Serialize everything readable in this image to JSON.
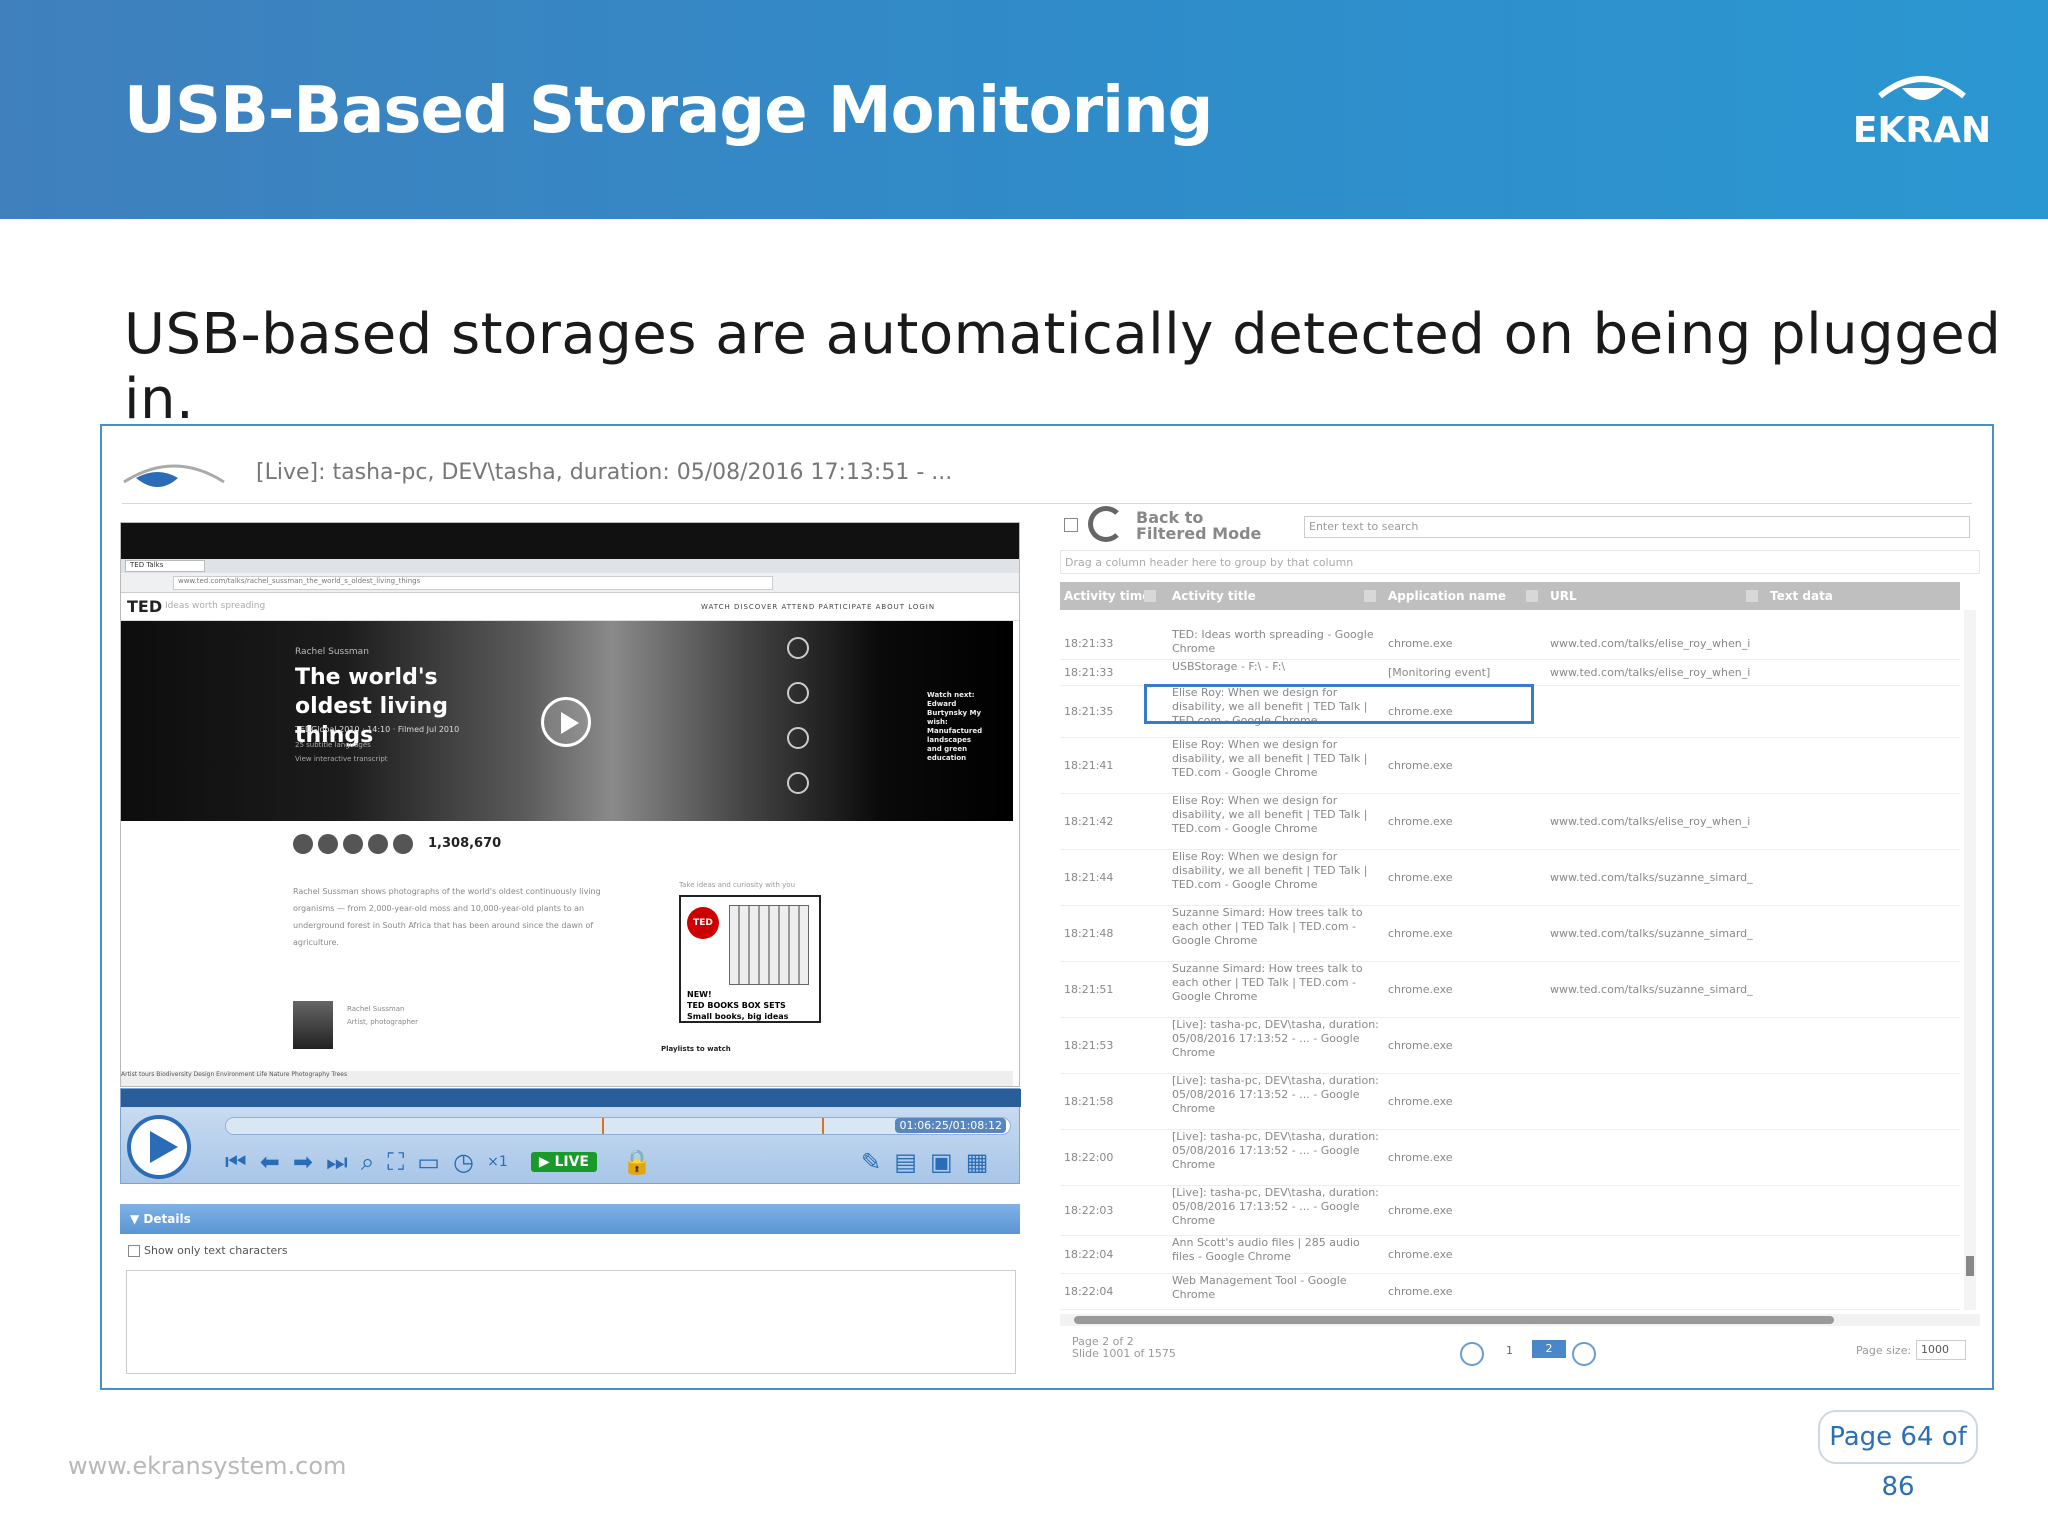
{
  "slide": {
    "title": "USB-Based Storage Monitoring",
    "subtitle": "USB-based storages are automatically detected on being plugged in.",
    "logo_text": "EKRAN",
    "page": "Page 64 of 86",
    "website": "www.ekransystem.com"
  },
  "session": {
    "header": "[Live]: tasha-pc, DEV\\tasha, duration: 05/08/2016 17:13:51 - ..."
  },
  "video": {
    "tab_label": "TED Talks",
    "address": "www.ted.com/talks/rachel_sussman_the_world_s_oldest_living_things",
    "ted_logo": "TED",
    "ted_tagline": "Ideas worth spreading",
    "menu": "WATCH   DISCOVER   ATTEND   PARTICIPATE   ABOUT   LOGIN",
    "speaker_name": "Rachel Sussman",
    "talk_title": "The world's oldest living things",
    "talk_meta": "TEDGlobal 2010 · 14:10 · Filmed Jul 2010",
    "subtitles": "25 subtitle languages",
    "download": "View interactive transcript",
    "side_text": "Watch next: Edward Burtynsky My wish: Manufactured landscapes and green education",
    "views": "1,308,670",
    "description": "Rachel Sussman shows photographs of the world's oldest continuously living organisms — from 2,000-year-old moss and 10,000-year-old plants to an underground forest in South Africa that has been around since the dawn of agriculture.",
    "ad_top": "Take ideas and curiosity with you",
    "ad_logo": "TED",
    "ad_label": "NEW!\nTED BOOKS BOX SETS\nSmall books, big ideas",
    "speaker_caption": "Rachel Sussman\nArtist, photographer",
    "playlist": "Playlists to watch",
    "strip": "Artist tours   Biodiversity   Design   Environment   Life   Nature   Photography   Trees"
  },
  "controls": {
    "timecode": "01:06:25/01:08:12",
    "live_label": "▶ LIVE",
    "speed": "×1",
    "progress_fraction": 0.89,
    "markers": [
      0.48,
      0.76
    ]
  },
  "details": {
    "title": "Details",
    "checkbox_label": "Show only text characters"
  },
  "grid": {
    "back_label": "Back to Filtered Mode",
    "search_placeholder": "Enter text to search",
    "group_hint": "Drag a column header here to group by that column",
    "columns": [
      "Activity time",
      "Activity title",
      "Application name",
      "URL",
      "Text data"
    ],
    "rows": [
      {
        "time": "18:21:33",
        "title": "TED: Ideas worth spreading - Google Chrome",
        "app": "chrome.exe",
        "url": "www.ted.com/talks/elise_roy_when_i"
      },
      {
        "time": "18:21:33",
        "title": "USBStorage - F:\\ - F:\\",
        "app": "[Monitoring event]",
        "url": "www.ted.com/talks/elise_roy_when_i"
      },
      {
        "time": "18:21:35",
        "title": "Elise Roy: When we design for disability, we all benefit | TED Talk | TED.com - Google Chrome",
        "app": "chrome.exe",
        "url": ""
      },
      {
        "time": "18:21:41",
        "title": "Elise Roy: When we design for disability, we all benefit | TED Talk | TED.com - Google Chrome",
        "app": "chrome.exe",
        "url": ""
      },
      {
        "time": "18:21:42",
        "title": "Elise Roy: When we design for disability, we all benefit | TED Talk | TED.com - Google Chrome",
        "app": "chrome.exe",
        "url": "www.ted.com/talks/elise_roy_when_i"
      },
      {
        "time": "18:21:44",
        "title": "Elise Roy: When we design for disability, we all benefit | TED Talk | TED.com - Google Chrome",
        "app": "chrome.exe",
        "url": "www.ted.com/talks/suzanne_simard_"
      },
      {
        "time": "18:21:48",
        "title": "Suzanne Simard: How trees talk to each other | TED Talk | TED.com - Google Chrome",
        "app": "chrome.exe",
        "url": "www.ted.com/talks/suzanne_simard_"
      },
      {
        "time": "18:21:51",
        "title": "Suzanne Simard: How trees talk to each other | TED Talk | TED.com - Google Chrome",
        "app": "chrome.exe",
        "url": "www.ted.com/talks/suzanne_simard_"
      },
      {
        "time": "18:21:53",
        "title": "[Live]: tasha-pc, DEV\\tasha, duration: 05/08/2016 17:13:52 - ... - Google Chrome",
        "app": "chrome.exe",
        "url": ""
      },
      {
        "time": "18:21:58",
        "title": "[Live]: tasha-pc, DEV\\tasha, duration: 05/08/2016 17:13:52 - ... - Google Chrome",
        "app": "chrome.exe",
        "url": ""
      },
      {
        "time": "18:22:00",
        "title": "[Live]: tasha-pc, DEV\\tasha, duration: 05/08/2016 17:13:52 - ... - Google Chrome",
        "app": "chrome.exe",
        "url": ""
      },
      {
        "time": "18:22:03",
        "title": "[Live]: tasha-pc, DEV\\tasha, duration: 05/08/2016 17:13:52 - ... - Google Chrome",
        "app": "chrome.exe",
        "url": ""
      },
      {
        "time": "18:22:04",
        "title": "Ann Scott's audio files | 285 audio files - Google Chrome",
        "app": "chrome.exe",
        "url": ""
      },
      {
        "time": "18:22:04",
        "title": "Web Management Tool - Google Chrome",
        "app": "chrome.exe",
        "url": ""
      }
    ],
    "pager_info": "Page 2 of 2\nSlide 1001 of 1575",
    "page_prev": "1",
    "page_current": "2",
    "page_size_label": "Page size:",
    "page_size": "1000"
  }
}
